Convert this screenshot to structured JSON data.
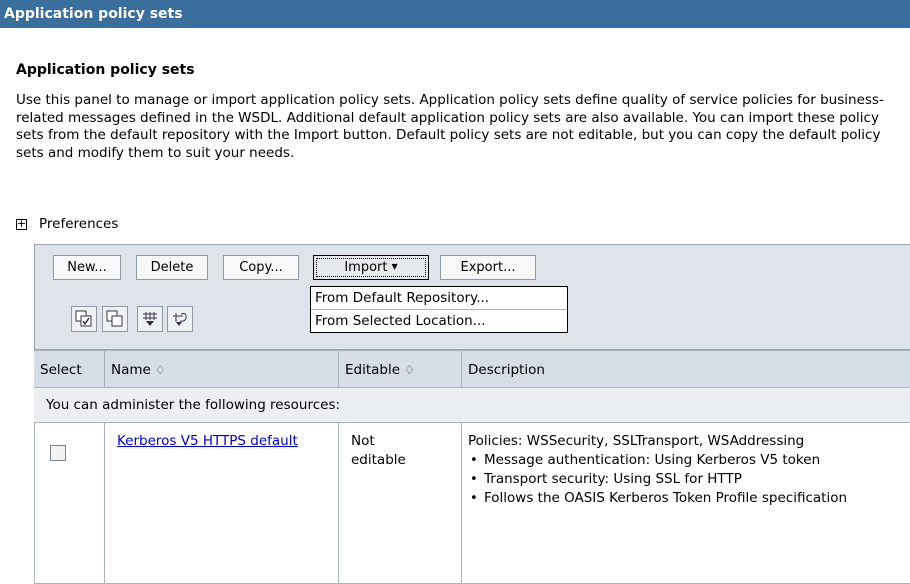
{
  "window": {
    "title": "Application policy sets"
  },
  "page": {
    "heading": "Application policy sets",
    "description": "Use this panel to manage or import application policy sets. Application policy sets define quality of service policies for business-related messages defined in the WSDL. Additional default application policy sets are also available. You can import these policy sets from the default repository with the Import button. Default policy sets are not editable, but you can copy the default policy sets and modify them to suit your needs.",
    "preferences_toggle": "+",
    "preferences_label": "Preferences"
  },
  "toolbar": {
    "new_label": "New...",
    "delete_label": "Delete",
    "copy_label": "Copy...",
    "import_label": "Import",
    "export_label": "Export..."
  },
  "import_menu": {
    "items": [
      "From Default Repository...",
      "From Selected Location..."
    ]
  },
  "icon_buttons": [
    "select-all-icon",
    "deselect-all-icon",
    "show-filter-icon",
    "clear-filter-icon"
  ],
  "table": {
    "columns": {
      "select": "Select",
      "name": "Name",
      "editable": "Editable",
      "description": "Description"
    },
    "sort_glyph": "♢",
    "info_text": "You can administer the following resources:",
    "rows": [
      {
        "name": "Kerberos V5 HTTPS default",
        "editable": "Not editable",
        "policies": "Policies: WSSecurity, SSLTransport, WSAddressing",
        "bullets": [
          "Message authentication: Using Kerberos V5 token",
          "Transport security: Using SSL for HTTP",
          "Follows the OASIS Kerberos Token Profile specification"
        ]
      }
    ]
  },
  "colors": {
    "titlebar": "#3a6f9d",
    "toolbar_bg": "#dfe4ea",
    "header_bg": "#d7dde4",
    "link": "#0000cc"
  }
}
